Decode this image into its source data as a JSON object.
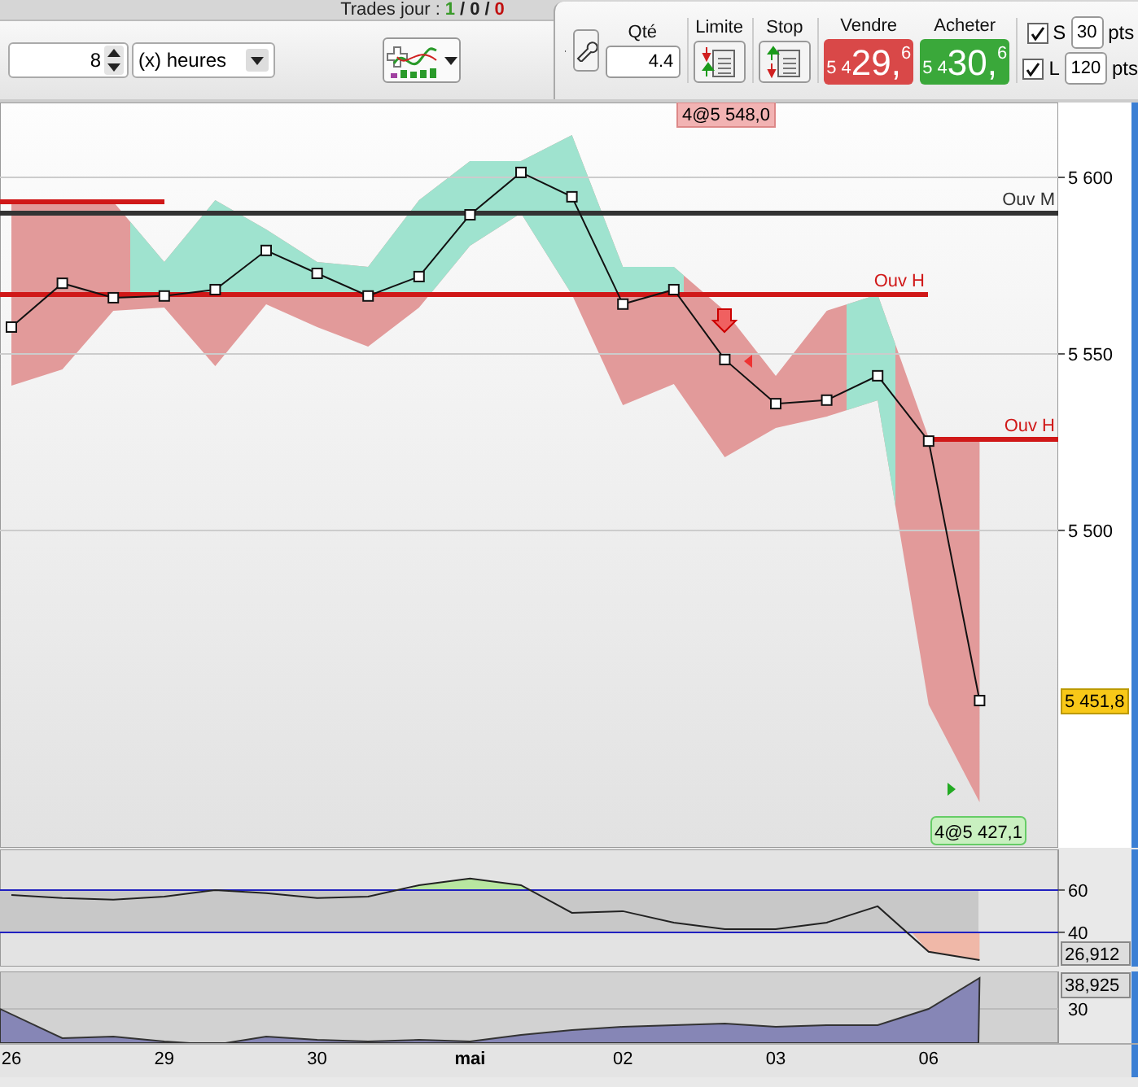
{
  "trades_today": {
    "label": "Trades jour :",
    "separator": "/",
    "counts": [
      {
        "value": "1",
        "color": "#3a9a2a"
      },
      {
        "value": "0",
        "color": "#222222"
      },
      {
        "value": "0",
        "color": "#c01010"
      }
    ]
  },
  "toolbar": {
    "period_value": "8",
    "period_unit": "(x) heures",
    "order": {
      "quantity_label": "Qté",
      "quantity": "4.4",
      "limit_label": "Limite",
      "stop_label": "Stop",
      "sell": {
        "label": "Vendre",
        "prefix": "5 4",
        "big": "29,",
        "suffix": "6"
      },
      "buy": {
        "label": "Acheter",
        "prefix": "5 4",
        "big": "30,",
        "suffix": "6"
      },
      "stops": [
        {
          "letter": "S",
          "checked": true,
          "value": "30",
          "unit": "pts"
        },
        {
          "letter": "L",
          "checked": true,
          "value": "120",
          "unit": "pts"
        }
      ]
    }
  },
  "price_chart": {
    "chart_data": {
      "type": "line",
      "grid": true,
      "categories": [
        null,
        null,
        null,
        null,
        null,
        null,
        null,
        null,
        null,
        null,
        null,
        null,
        null,
        null,
        null,
        null,
        null,
        null,
        null,
        null
      ],
      "series": [
        {
          "color": "#111111",
          "marker": "square",
          "values": [
            5557.6,
            5570.0,
            5565.9,
            5566.4,
            5568.2,
            5579.3,
            5572.8,
            5566.4,
            5571.9,
            5589.4,
            5601.4,
            5594.5,
            5564.1,
            5568.2,
            5548.4,
            5535.9,
            5536.9,
            5543.8,
            5525.3,
            5451.8
          ]
        }
      ],
      "ylim": [
        5410.1,
        5621.2
      ],
      "yticks": [
        {
          "value": 5600,
          "label": "5 600"
        },
        {
          "value": 5550,
          "label": "5 550"
        },
        {
          "value": 5500,
          "label": "5 500"
        }
      ]
    },
    "levels": [
      {
        "color": "#d01818"
      },
      {
        "label": "Ouv M",
        "color": "#333333"
      },
      {
        "label": "Ouv H",
        "color": "#d01818"
      },
      {
        "label": "Ouv H",
        "color": "#d01818"
      }
    ],
    "sell_marker": "4@5 548,0",
    "buy_marker": "4@5 427,1",
    "last_price": "5 451,8"
  },
  "indicator_chart": {
    "chart_data": {
      "type": "line",
      "categories": [
        null,
        null,
        null,
        null,
        null,
        null,
        null,
        null,
        null,
        null,
        null,
        null,
        null,
        null,
        null,
        null,
        null,
        null,
        null,
        null
      ],
      "series": [
        {
          "color": "#222222",
          "values": [
            57.7,
            56.2,
            55.4,
            56.9,
            60.0,
            58.5,
            56.2,
            56.9,
            62.3,
            65.4,
            62.3,
            49.2,
            50.0,
            44.6,
            41.5,
            41.5,
            44.6,
            52.3,
            30.8,
            26.9
          ]
        }
      ],
      "ylim": [
        23.8,
        79.2
      ],
      "yticks": [
        60,
        40
      ]
    },
    "last_value": "26,912"
  },
  "volume_panel": {
    "tick": "30",
    "last_value": "38,925"
  },
  "date_axis": [
    {
      "label": "26",
      "kind": "day"
    },
    {
      "label": "29",
      "kind": "day"
    },
    {
      "label": "30",
      "kind": "day"
    },
    {
      "label": "mai",
      "kind": "month"
    },
    {
      "label": "02",
      "kind": "day"
    },
    {
      "label": "03",
      "kind": "day"
    },
    {
      "label": "06",
      "kind": "day"
    }
  ]
}
